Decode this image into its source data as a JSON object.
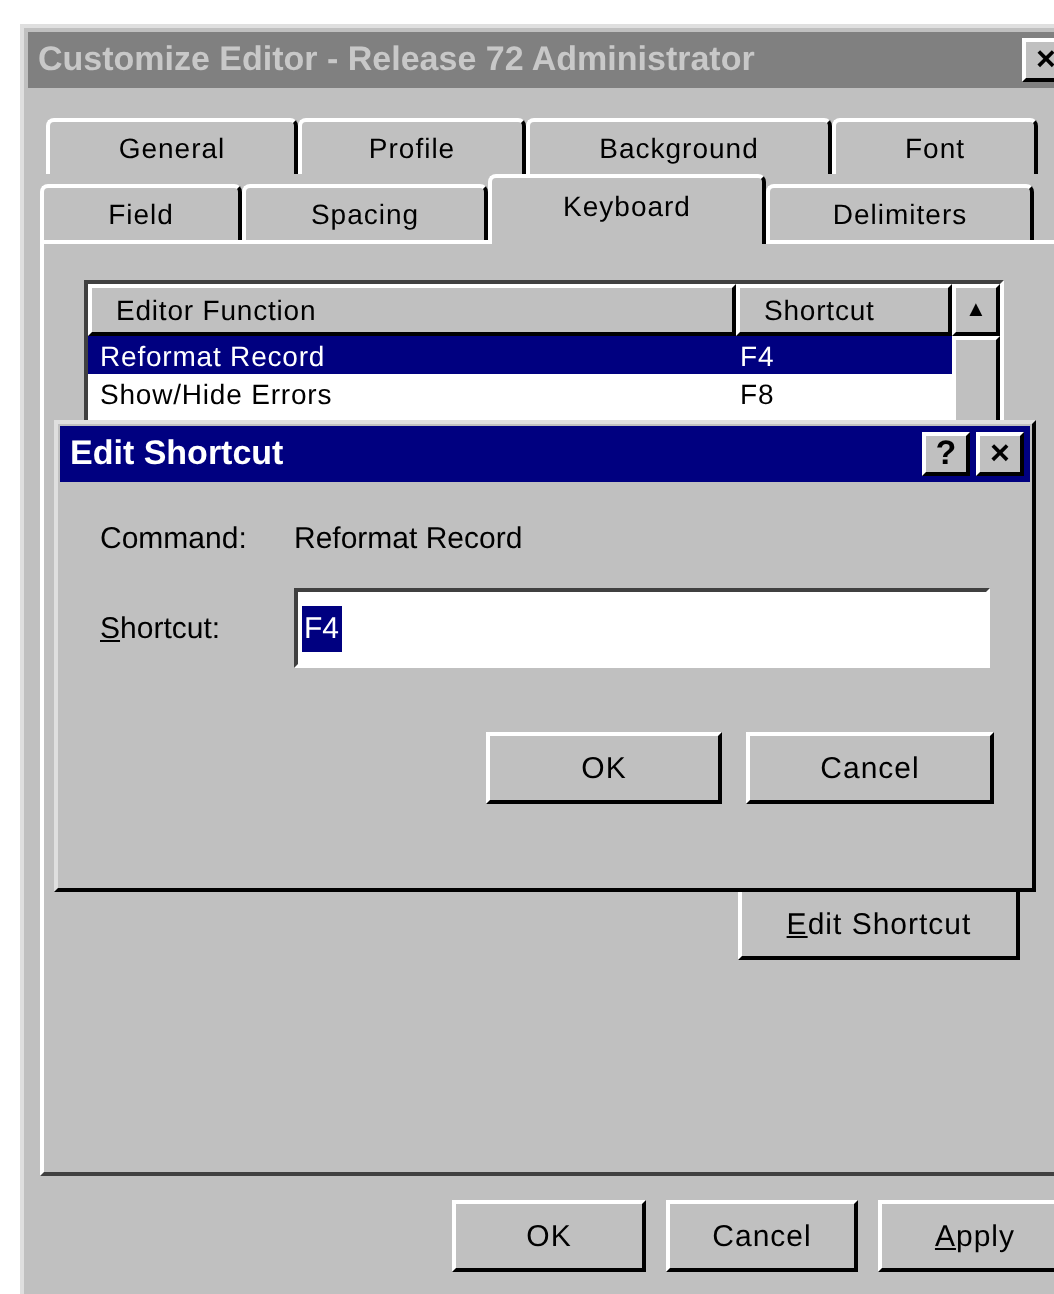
{
  "window": {
    "title": "Customize Editor - Release 72 Administrator",
    "active": false,
    "close": "×"
  },
  "tab_rows": [
    [
      {
        "label": "General",
        "selected": false
      },
      {
        "label": "Profile",
        "selected": false
      },
      {
        "label": "Background",
        "selected": false
      },
      {
        "label": "Font",
        "selected": false
      }
    ],
    [
      {
        "label": "Field",
        "selected": false
      },
      {
        "label": "Spacing",
        "selected": false
      },
      {
        "label": "Keyboard",
        "selected": true
      },
      {
        "label": "Delimiters",
        "selected": false
      }
    ]
  ],
  "table": {
    "columns": [
      "Editor Function",
      "Shortcut"
    ],
    "scroll_up": "▲",
    "rows": [
      {
        "function": "Reformat Record",
        "shortcut": "F4",
        "selected": true
      },
      {
        "function": "Show/Hide Errors",
        "shortcut": "F8",
        "selected": false
      }
    ]
  },
  "edit_button": {
    "accel": "E",
    "rest": "dit Shortcut"
  },
  "buttons": [
    {
      "rest": "OK"
    },
    {
      "rest": "Cancel"
    },
    {
      "accel": "A",
      "rest": "pply"
    }
  ],
  "dialog": {
    "title": "Edit Shortcut",
    "active": true,
    "help": "?",
    "close": "×",
    "command_label": "Command:",
    "command_value": "Reformat Record",
    "shortcut_label": {
      "accel": "S",
      "rest": "hortcut:"
    },
    "shortcut_value": "F4",
    "value_selected": true,
    "buttons": [
      "OK",
      "Cancel"
    ]
  }
}
